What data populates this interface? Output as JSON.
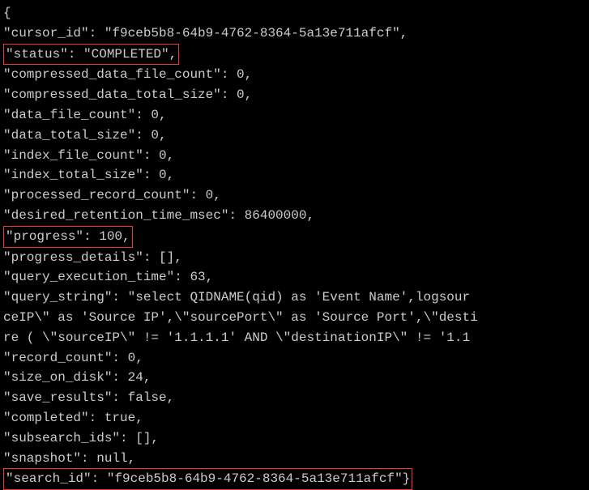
{
  "json_output": {
    "opening_brace": "{",
    "cursor_id_line": "\"cursor_id\": \"f9ceb5b8-64b9-4762-8364-5a13e711afcf\",",
    "status_line": "\"status\": \"COMPLETED\",",
    "compressed_data_file_count_line": "\"compressed_data_file_count\": 0,",
    "compressed_data_total_size_line": "\"compressed_data_total_size\": 0,",
    "data_file_count_line": "\"data_file_count\": 0,",
    "data_total_size_line": "\"data_total_size\": 0,",
    "index_file_count_line": "\"index_file_count\": 0,",
    "index_total_size_line": "\"index_total_size\": 0,",
    "processed_record_count_line": "\"processed_record_count\": 0,",
    "desired_retention_time_msec_line": "\"desired_retention_time_msec\": 86400000,",
    "progress_line": "\"progress\": 100,",
    "progress_details_line": "\"progress_details\": [],",
    "query_execution_time_line": "\"query_execution_time\": 63,",
    "query_string_line1": "\"query_string\": \"select QIDNAME(qid) as 'Event Name',logsour",
    "query_string_line2": "ceIP\\\" as 'Source IP',\\\"sourcePort\\\" as 'Source Port',\\\"desti",
    "query_string_line3": "re ( \\\"sourceIP\\\" != '1.1.1.1' AND \\\"destinationIP\\\" != '1.1",
    "record_count_line": "\"record_count\": 0,",
    "size_on_disk_line": "\"size_on_disk\": 24,",
    "save_results_line": "\"save_results\": false,",
    "completed_line": "\"completed\": true,",
    "subsearch_ids_line": "\"subsearch_ids\": [],",
    "snapshot_line": "\"snapshot\": null,",
    "search_id_line": "\"search_id\": \"f9ceb5b8-64b9-4762-8364-5a13e711afcf\"}"
  }
}
